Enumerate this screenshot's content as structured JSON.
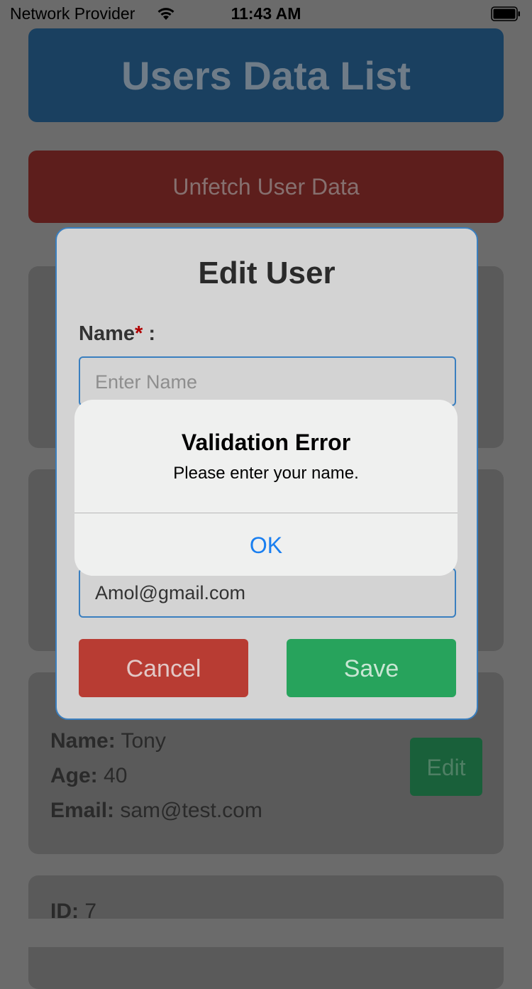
{
  "status_bar": {
    "carrier": "Network Provider",
    "time": "11:43 AM",
    "wifi_icon": "wifi-icon",
    "battery_icon": "battery-icon"
  },
  "app": {
    "title": "Users Data List",
    "unfetch_button_label": "Unfetch User Data",
    "card_3": {
      "name_label": "Name:",
      "name_value": " Tony",
      "age_label": "Age:",
      "age_value": " 40",
      "email_label": "Email:",
      "email_value": " sam@test.com",
      "edit_label": "Edit"
    },
    "card_4": {
      "id_label": "ID:",
      "id_value": " 7"
    }
  },
  "edit_modal": {
    "title": "Edit User",
    "name_label": "Name",
    "required_mark": "*",
    "name_label_suffix": " :",
    "name_placeholder": "Enter Name",
    "email_value": "Amol@gmail.com",
    "cancel_label": "Cancel",
    "save_label": "Save"
  },
  "alert": {
    "title": "Validation Error",
    "message": "Please enter your name.",
    "ok_label": "OK"
  },
  "colors": {
    "accent": "#1a7ff0",
    "danger": "#b83c33",
    "success": "#27a35c",
    "modal_border": "#3a7fbf"
  }
}
